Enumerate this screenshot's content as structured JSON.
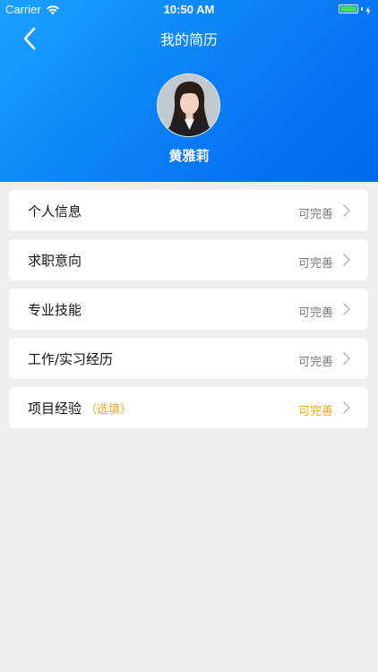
{
  "status_bar": {
    "carrier": "Carrier",
    "time": "10:50 AM",
    "battery_level": 1.0,
    "battery_color": "#4cd964"
  },
  "header": {
    "title": "我的简历",
    "back_icon": "chevron-left-icon",
    "gradient_start": "#1aa2ff",
    "gradient_end": "#0066f0"
  },
  "profile": {
    "name": "黄雅莉",
    "avatar_icon": "avatar-photo"
  },
  "sections": [
    {
      "label": "个人信息",
      "optional": "",
      "status": "可完善",
      "status_color": "#7a7a7a"
    },
    {
      "label": "求职意向",
      "optional": "",
      "status": "可完善",
      "status_color": "#7a7a7a"
    },
    {
      "label": "专业技能",
      "optional": "",
      "status": "可完善",
      "status_color": "#7a7a7a"
    },
    {
      "label": "工作/实习经历",
      "optional": "",
      "status": "可完善",
      "status_color": "#7a7a7a"
    },
    {
      "label": "项目经验",
      "optional": "（选填）",
      "status": "可完善",
      "status_color": "#f5a623"
    }
  ],
  "colors": {
    "background": "#eeeeee",
    "card": "#ffffff",
    "accent_orange": "#f5a623"
  }
}
